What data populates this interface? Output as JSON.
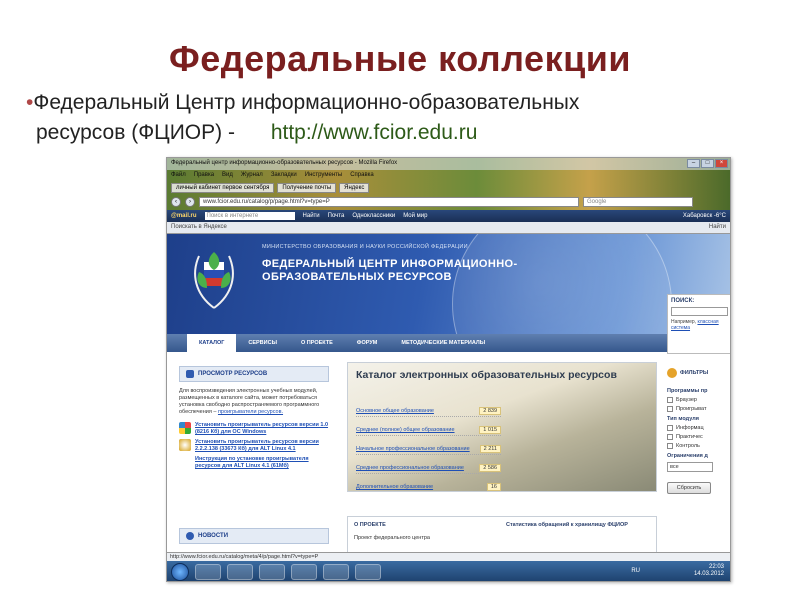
{
  "slide": {
    "title": "Федеральные коллекции",
    "bullet_line1": "Федеральный Центр информационно-образовательных",
    "bullet_line2": "ресурсов (ФЦИОР)  -",
    "url": "http://www.fcior.edu.ru"
  },
  "browser": {
    "window_title": "Федеральный центр информационно-образовательных ресурсов - Mozilla Firefox",
    "menu": [
      "Файл",
      "Правка",
      "Вид",
      "Журнал",
      "Закладки",
      "Инструменты",
      "Справка"
    ],
    "tabs": [
      "личный кабинет первое сентября",
      "Получение почты",
      "Яндекс"
    ],
    "address": "www.fcior.edu.ru/catalog/p/page.html?v=type=P",
    "search_placeholder": "Google",
    "mailru": {
      "logo": "@mail.ru",
      "search_placeholder": "Поиск в интернете",
      "find": "Найти",
      "links": [
        "Почта",
        "Одноклассники",
        "Мой мир"
      ],
      "weather": "Хабаровск -6°C"
    },
    "yandex": {
      "placeholder": "Поискать в Яндексе",
      "find": "Найти"
    },
    "status_url": "http://www.fcior.edu.ru/catalog/meta/4/p/page.html?v=type=P",
    "tray_lang": "RU",
    "tray_time": "22:03",
    "tray_date": "14.03.2012"
  },
  "site": {
    "ministry": "МИНИСТЕРСТВО ОБРАЗОВАНИЯ И НАУКИ РОССИЙСКОЙ ФЕДЕРАЦИИ",
    "name": "ФЕДЕРАЛЬНЫЙ ЦЕНТР ИНФОРМАЦИОННО-ОБРАЗОВАТЕЛЬНЫХ РЕСУРСОВ",
    "nav": [
      "КАТАЛОГ",
      "СЕРВИСЫ",
      "О ПРОЕКТЕ",
      "ФОРУМ",
      "МЕТОДИЧЕСКИЕ МАТЕРИАЛЫ"
    ],
    "search": {
      "label": "ПОИСК:",
      "example_prefix": "Например,",
      "example_link": "классная система"
    },
    "left": {
      "heading": "ПРОСМОТР РЕСУРСОВ",
      "text": "Для воспроизведения электронных учебных модулей, размещенных в каталоге сайта, может потребоваться установка свободно распространяемого программного обеспечения –",
      "text_link": "проигрыватели ресурсов.",
      "downloads": [
        "Установить проигрыватель ресурсов версии 1.0 (8216 Кб) для ОС Windows",
        "Установить проигрыватель ресурсов версии 2.2.2.138 (33673 Кб) для ALT Linux 4.1",
        "Инструкция по установке проигрывателя ресурсов для ALT Linux 4.1 (61Мб)"
      ],
      "news_heading": "НОВОСТИ"
    },
    "catalog": {
      "title": "Каталог электронных образовательных ресурсов",
      "rows": [
        {
          "label": "Основное общее образование",
          "count": "2 839"
        },
        {
          "label": "Среднее (полное) общее образование",
          "count": "1 015"
        },
        {
          "label": "Начальное профессиональное образование",
          "count": "2 211"
        },
        {
          "label": "Среднее профессиональное образование",
          "count": "2 586"
        },
        {
          "label": "Дополнительное образование",
          "count": "16"
        }
      ]
    },
    "about": {
      "title": "О ПРОЕКТЕ",
      "text": "Проект федерального центра",
      "stats": "Статистика обращений к хранилищу ФЦИОР"
    },
    "filters": {
      "heading": "ФИЛЬТРЫ",
      "programs_label": "Программы пр",
      "programs": [
        "Браузер",
        "Проигрыват"
      ],
      "type_label": "Тип модуля",
      "types": [
        "Информац",
        "Практичес",
        "Контроль"
      ],
      "limit_label": "Ограничения д",
      "limit_value": "все",
      "reset": "Сбросить"
    }
  }
}
